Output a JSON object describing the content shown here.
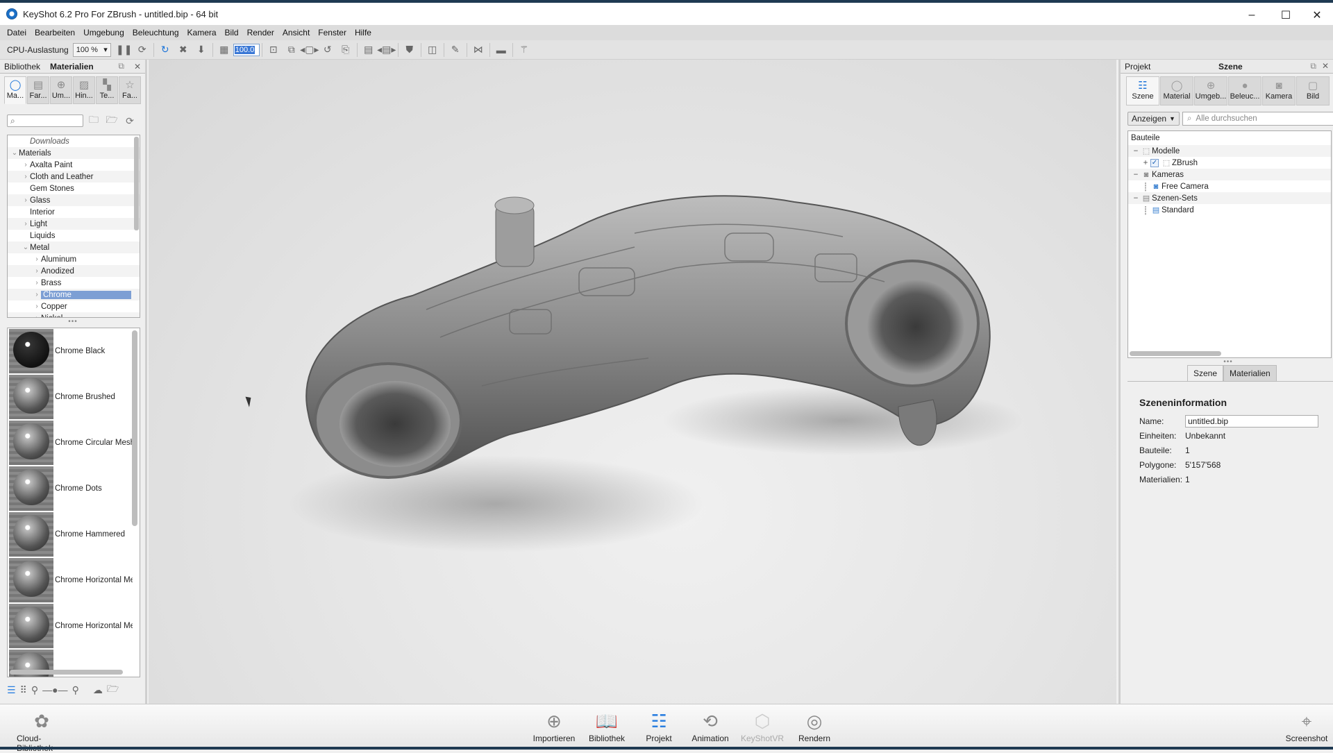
{
  "window": {
    "title": "KeyShot 6.2 Pro For ZBrush - untitled.bip  - 64 bit",
    "controls": {
      "minimize": "–",
      "maximize": "☐",
      "close": "✕"
    }
  },
  "menu": [
    "Datei",
    "Bearbeiten",
    "Umgebung",
    "Beleuchtung",
    "Kamera",
    "Bild",
    "Render",
    "Ansicht",
    "Fenster",
    "Hilfe"
  ],
  "toolbar": {
    "cpu_label": "CPU-Auslastung",
    "cpu_value": "100 %",
    "zoom_value": "100.0",
    "icons": [
      "pause-icon",
      "performance-mode-icon",
      "refresh-icon",
      "fit-icon",
      "drop-to-ground-icon",
      "region-icon",
      "zoom-input",
      "screenshot-icon",
      "screenshot-settings-icon",
      "previous-camera-icon",
      "reset-icon",
      "lock-icon",
      "add-studio-icon",
      "studio-nav-icon",
      "shield-icon",
      "layout-icon",
      "paint-icon",
      "geometry-icon",
      "console-icon",
      "zbrush-icon"
    ]
  },
  "library": {
    "header": {
      "tab1": "Bibliothek",
      "tab2": "Materialien"
    },
    "tabs": [
      {
        "label": "Ma...",
        "icon": "material-icon",
        "active": true
      },
      {
        "label": "Far...",
        "icon": "colors-icon"
      },
      {
        "label": "Um...",
        "icon": "environment-icon"
      },
      {
        "label": "Hin...",
        "icon": "backplate-icon"
      },
      {
        "label": "Te...",
        "icon": "texture-icon"
      },
      {
        "label": "Fa...",
        "icon": "favorites-icon"
      }
    ],
    "search_placeholder": "",
    "tree": [
      {
        "label": "Downloads",
        "level": 1,
        "arrow": "",
        "italic": true
      },
      {
        "label": "Materials",
        "level": 0,
        "arrow": "⌄"
      },
      {
        "label": "Axalta Paint",
        "level": 1,
        "arrow": "›"
      },
      {
        "label": "Cloth and Leather",
        "level": 1,
        "arrow": "›"
      },
      {
        "label": "Gem Stones",
        "level": 1,
        "arrow": ""
      },
      {
        "label": "Glass",
        "level": 1,
        "arrow": "›"
      },
      {
        "label": "Interior",
        "level": 1,
        "arrow": ""
      },
      {
        "label": "Light",
        "level": 1,
        "arrow": "›"
      },
      {
        "label": "Liquids",
        "level": 1,
        "arrow": ""
      },
      {
        "label": "Metal",
        "level": 1,
        "arrow": "⌄"
      },
      {
        "label": "Aluminum",
        "level": 2,
        "arrow": "›"
      },
      {
        "label": "Anodized",
        "level": 2,
        "arrow": "›"
      },
      {
        "label": "Brass",
        "level": 2,
        "arrow": "›"
      },
      {
        "label": "Chrome",
        "level": 2,
        "arrow": "›",
        "selected": true
      },
      {
        "label": "Copper",
        "level": 2,
        "arrow": "›"
      },
      {
        "label": "Nickel",
        "level": 2,
        "arrow": "›"
      }
    ],
    "materials": [
      {
        "name": "Chrome Black",
        "dark": true
      },
      {
        "name": "Chrome Brushed"
      },
      {
        "name": "Chrome Circular Mesh"
      },
      {
        "name": "Chrome Dots"
      },
      {
        "name": "Chrome Hammered"
      },
      {
        "name": "Chrome Horizontal Me"
      },
      {
        "name": "Chrome Horizontal Me"
      },
      {
        "name": ""
      }
    ]
  },
  "cloud_library_label": "Cloud-Bibliothek",
  "project": {
    "header": {
      "left": "Projekt",
      "center": "Szene"
    },
    "tabs": [
      {
        "label": "Szene",
        "icon": "scene-icon",
        "active": true
      },
      {
        "label": "Material",
        "icon": "material-icon"
      },
      {
        "label": "Umgeb...",
        "icon": "environment-icon"
      },
      {
        "label": "Beleuc...",
        "icon": "lighting-icon"
      },
      {
        "label": "Kamera",
        "icon": "camera-icon"
      },
      {
        "label": "Bild",
        "icon": "image-icon"
      }
    ],
    "show_button": "Anzeigen",
    "search_placeholder": "Alle durchsuchen",
    "tree_header": "Bauteile",
    "tree": [
      {
        "label": "Modelle",
        "exp": "−",
        "indent": 0,
        "icon": "models-icon"
      },
      {
        "label": "ZBrush",
        "exp": "+",
        "indent": 1,
        "icon": "model-icon",
        "checked": true
      },
      {
        "label": "Kameras",
        "exp": "−",
        "indent": 0,
        "icon": "cameras-icon"
      },
      {
        "label": "Free Camera",
        "exp": "",
        "indent": 1,
        "icon": "camera-icon",
        "blue": true
      },
      {
        "label": "Szenen-Sets",
        "exp": "−",
        "indent": 0,
        "icon": "scene-sets-icon"
      },
      {
        "label": "Standard",
        "exp": "",
        "indent": 1,
        "icon": "scene-set-icon",
        "blue": true
      }
    ],
    "bottom_tabs": [
      {
        "label": "Szene",
        "active": true
      },
      {
        "label": "Materialien"
      }
    ],
    "info": {
      "title": "Szeneninformation",
      "name_label": "Name:",
      "name_value": "untitled.bip",
      "rows": [
        {
          "k": "Einheiten:",
          "v": "Unbekannt"
        },
        {
          "k": "Bauteile:",
          "v": "1"
        },
        {
          "k": "Polygone:",
          "v": "5'157'568"
        },
        {
          "k": "Materialien:",
          "v": "1"
        }
      ]
    }
  },
  "bottombar": [
    {
      "label": "Importieren",
      "icon": "import-icon"
    },
    {
      "label": "Bibliothek",
      "icon": "library-icon",
      "active": true
    },
    {
      "label": "Projekt",
      "icon": "project-icon",
      "active": true
    },
    {
      "label": "Animation",
      "icon": "animation-icon"
    },
    {
      "label": "KeyShotVR",
      "icon": "keyshotvr-icon",
      "disabled": true
    },
    {
      "label": "Rendern",
      "icon": "render-icon"
    }
  ],
  "screenshot_label": "Screenshot"
}
